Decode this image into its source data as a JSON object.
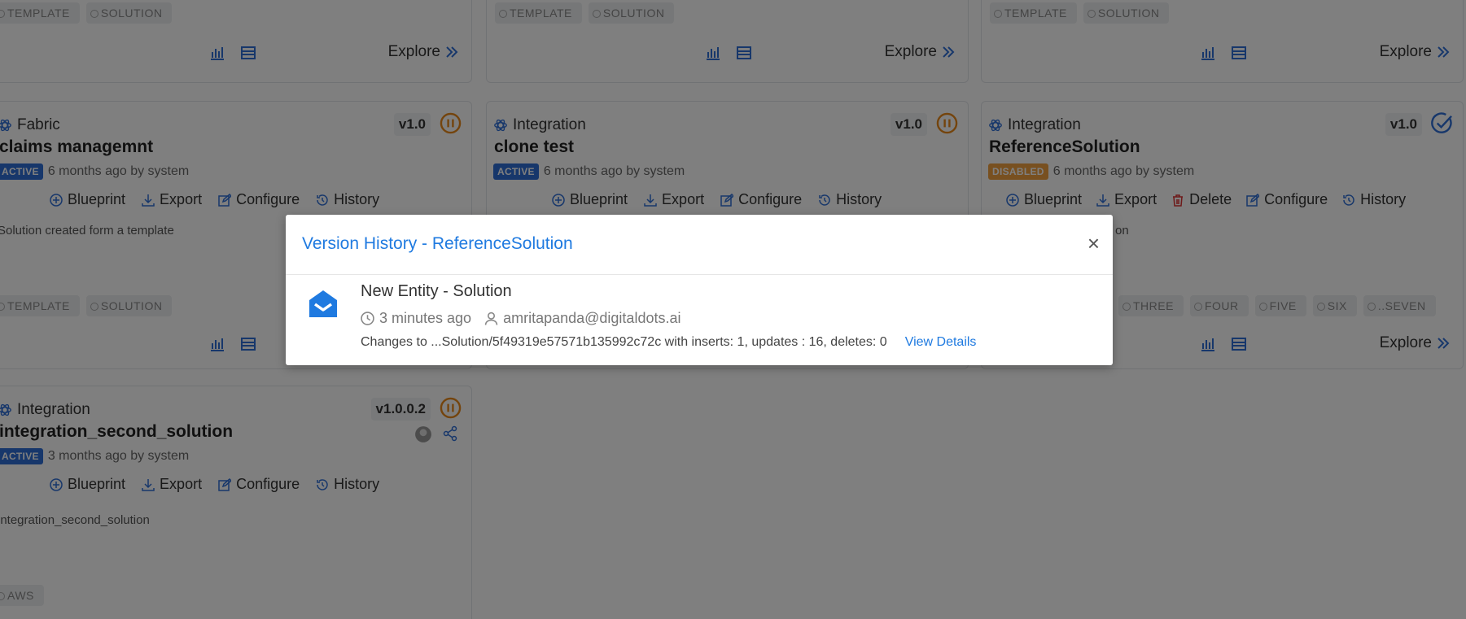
{
  "colors": {
    "accent": "#1f7ae0",
    "pause": "#e8891a",
    "active_badge": "#2f6fd6",
    "disabled_badge": "#f0a040"
  },
  "top_row": {
    "tags": [
      "TEMPLATE",
      "SOLUTION"
    ],
    "explore_label": "Explore"
  },
  "cards": [
    {
      "type": "Fabric",
      "version": "v1.0",
      "status_icon": "pause-circle-icon",
      "title": "claims managemnt",
      "badge": "ACTIVE",
      "meta": "6 months ago by system",
      "actions": [
        "Blueprint",
        "Export",
        "Configure",
        "History"
      ],
      "description": "Solution created form a template",
      "tags": [
        "TEMPLATE",
        "SOLUTION"
      ],
      "explore_label": "Explore"
    },
    {
      "type": "Integration",
      "version": "v1.0",
      "status_icon": "pause-circle-icon",
      "title": "clone test",
      "badge": "ACTIVE",
      "meta": "6 months ago by system",
      "actions": [
        "Blueprint",
        "Export",
        "Configure",
        "History"
      ],
      "explore_label": "Explore"
    },
    {
      "type": "Integration",
      "version": "v1.0",
      "status_icon": "check-circle-icon",
      "title": "ReferenceSolution",
      "badge": "DISABLED",
      "meta": "6 months ago by system",
      "actions": [
        "Blueprint",
        "Export",
        "Delete",
        "Configure",
        "History"
      ],
      "description_fragment": "on",
      "tags": [
        "THREE",
        "FOUR",
        "FIVE",
        "SIX",
        "..SEVEN"
      ],
      "explore_label": "Explore"
    },
    {
      "type": "Integration",
      "version": "v1.0.0.2",
      "status_icon": "pause-circle-icon",
      "title": "integration_second_solution",
      "badge": "ACTIVE",
      "meta": "3 months ago by system",
      "actions": [
        "Blueprint",
        "Export",
        "Configure",
        "History"
      ],
      "description": "integration_second_solution",
      "tags": [
        "AWS"
      ]
    }
  ],
  "modal": {
    "title": "Version History - ReferenceSolution",
    "close": "×",
    "entry": {
      "title": "New Entity - Solution",
      "time": "3 minutes ago",
      "user": "amritapanda@digitaldots.ai",
      "changes": "Changes to ...Solution/5f49319e57571b135992c72c with inserts: 1, updates : 16, deletes: 0",
      "link": "View Details"
    }
  }
}
